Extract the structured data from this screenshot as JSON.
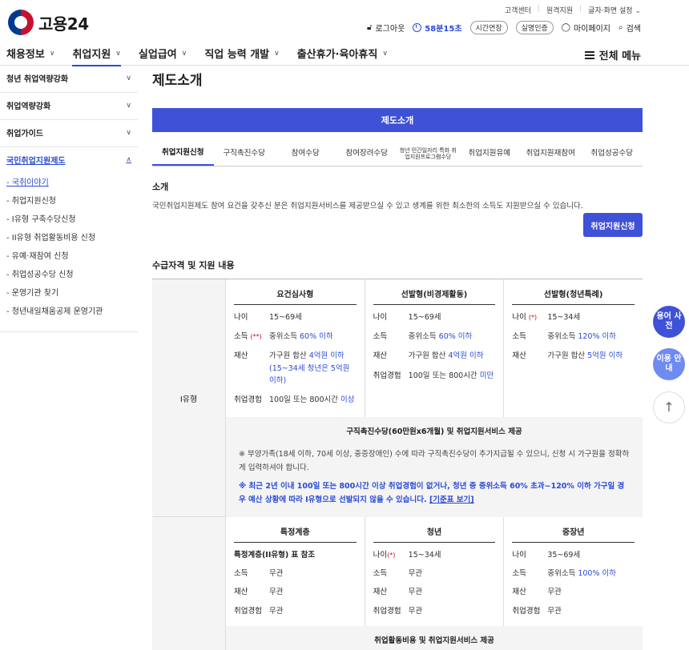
{
  "util": {
    "customer": "고객센터",
    "remote": "원격지원",
    "font": "글자·화면 설정"
  },
  "brand": {
    "name": "고용24"
  },
  "header": {
    "logout": "로그아웃",
    "timer": "58분15초",
    "extend": "시간연장",
    "cert": "실명인증",
    "mypage": "마이페이지",
    "search": "검색"
  },
  "gnb": {
    "items": [
      {
        "label": "채용정보"
      },
      {
        "label": "취업지원"
      },
      {
        "label": "실업급여"
      },
      {
        "label": "직업 능력 개발"
      },
      {
        "label": "출산휴가·육아휴직"
      }
    ],
    "all_menu": "전체 메뉴"
  },
  "sidebar": {
    "sections": [
      {
        "label": "청년 취업역량강화"
      },
      {
        "label": "취업역량강화"
      },
      {
        "label": "취업가이드"
      },
      {
        "label": "국민취업지원제도"
      }
    ],
    "subs": [
      {
        "label": "- 국취이야기"
      },
      {
        "label": "- 취업지원신청"
      },
      {
        "label": "- I유형 구축수당신청"
      },
      {
        "label": "- II유형 취업활동비용 신청"
      },
      {
        "label": "- 유예·재참여 신청"
      },
      {
        "label": "- 취업성공수당 신청"
      },
      {
        "label": "- 운영기관 찾기"
      },
      {
        "label": "- 청년내일채움공제 운영기관"
      }
    ]
  },
  "main": {
    "title": "제도소개",
    "banner": "제도소개",
    "tabs": [
      {
        "label": "취업지원신청"
      },
      {
        "label": "구직촉진수당"
      },
      {
        "label": "참여수당"
      },
      {
        "label": "참여장려수당"
      },
      {
        "label": "청년 민간일자리 특화 취업지원프로그램수당"
      },
      {
        "label": "취업지원유예"
      },
      {
        "label": "취업지원재참여"
      },
      {
        "label": "취업성공수당"
      }
    ],
    "intro_title": "소개",
    "intro_desc": "국민취업지원제도 참여 요건을 갖추신 분은 취업지원서비스를 제공받으실 수 있고 생계를 위한 최소한의 소득도 지원받으실 수 있습니다.",
    "apply_btn": "취업지원신청",
    "qual_title": "수급자격 및 지원 내용"
  },
  "table": {
    "row1": {
      "head": "I유형",
      "cols": [
        {
          "title": "요건심사형",
          "age_k": "나이",
          "age_v": "15~69세",
          "inc_k": "소득",
          "inc_mark": "(**)",
          "inc_v1": "중위소득 ",
          "inc_v2": "60% 이하",
          "asset_k": "재산",
          "asset_v1": "가구원 합산 ",
          "asset_v2": "4억원 이하",
          "asset_v3": "(15~34세 청년은 5억원 이하)",
          "exp_k": "취업경험",
          "exp_v1": "100일 또는 800시간 ",
          "exp_v2": "이상"
        },
        {
          "title": "선발형(비경제활동)",
          "age_k": "나이",
          "age_v": "15~69세",
          "inc_k": "소득",
          "inc_v1": "중위소득 ",
          "inc_v2": "60% 이하",
          "asset_k": "재산",
          "asset_v1": "가구원 합산 ",
          "asset_v2": "4억원 이하",
          "exp_k": "취업경험",
          "exp_v1": "100일 또는 800시간 ",
          "exp_v2": "미만"
        },
        {
          "title": "선발형(청년특례)",
          "age_k": "나이",
          "age_mark": "(*)",
          "age_v": "15~34세",
          "inc_k": "소득",
          "inc_v1": "중위소득 ",
          "inc_v2": "120% 이하",
          "asset_k": "재산",
          "asset_v1": "가구원 합산 ",
          "asset_v2": "5억원 이하"
        }
      ],
      "box_title": "구직촉진수당(60만원x6개월) 및 취업지원서비스 제공",
      "note1": "※ 부양가족(18세 이하, 70세 이상, 중증장애인) 수에 따라 구직촉진수당이 추가지급될 수 있으니, 신청 시 가구원을 정확하게 입력하셔야 합니다.",
      "note2": "※ 최근 2년 이내 100일 또는 800시간 이상 취업경험이 없거나, 청년 중 중위소득 60% 초과~120% 이하 가구일 경우 예산 상황에 따라 I유형으로 선발되지 않을 수 있습니다. ",
      "note2_link": "[기준표 보기]"
    },
    "row2": {
      "cols": [
        {
          "title": "특정계층",
          "ref": "특정계층(II유형) 표 참조",
          "inc_k": "소득",
          "inc_v": "무관",
          "asset_k": "재산",
          "asset_v": "무관",
          "exp_k": "취업경험",
          "exp_v": "무관"
        },
        {
          "title": "청년",
          "age_k": "나이",
          "age_mark": "(*)",
          "age_v": "15~34세",
          "inc_k": "소득",
          "inc_v": "무관",
          "asset_k": "재산",
          "asset_v": "무관",
          "exp_k": "취업경험",
          "exp_v": "무관"
        },
        {
          "title": "중장년",
          "age_k": "나이",
          "age_v": "35~69세",
          "inc_k": "소득",
          "inc_v1": "중위소득 ",
          "inc_v2": "100% 이하",
          "asset_k": "재산",
          "asset_v": "무관",
          "exp_k": "취업경험",
          "exp_v": "무관"
        }
      ],
      "box_title": "취업활동비용 및 취업지원서비스 제공"
    }
  },
  "fab": {
    "glossary": "용어 사전",
    "guide": "이용 안내",
    "top": "↑"
  }
}
